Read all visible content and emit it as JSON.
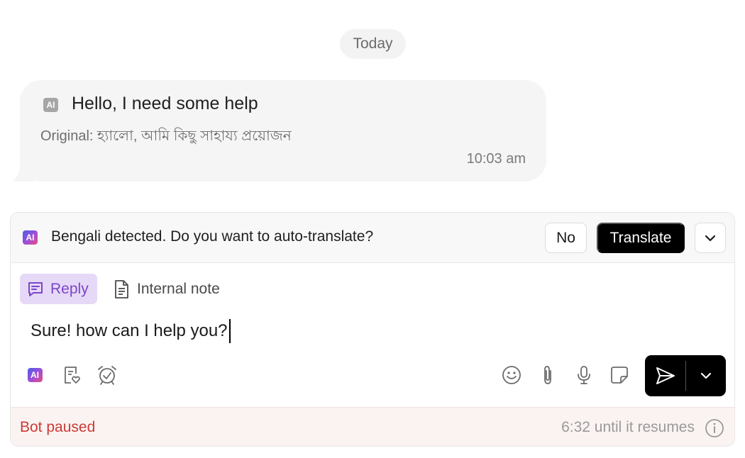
{
  "chat": {
    "date_divider": "Today",
    "message": {
      "ai_badge": "AI",
      "text": "Hello, I need some help",
      "original": "Original: হ্যালো, আমি কিছু সাহায্য প্রয়োজন",
      "time": "10:03 am"
    }
  },
  "translate_bar": {
    "ai_badge": "AI",
    "prompt": "Bengali detected. Do you want to auto-translate?",
    "no_label": "No",
    "translate_label": "Translate"
  },
  "composer": {
    "tabs": [
      {
        "label": "Reply",
        "active": true
      },
      {
        "label": "Internal note",
        "active": false
      }
    ],
    "input_value": "Sure! how can I help you?",
    "ai_badge": "AI",
    "left_tools": [
      "ai-assist-icon",
      "knowledge-doc-icon",
      "snooze-alarm-icon"
    ],
    "right_tools": [
      "emoji-icon",
      "attachment-icon",
      "microphone-icon",
      "sticker-icon"
    ],
    "send_icon": "send-icon"
  },
  "status": {
    "bot_state": "Bot paused",
    "resume_text": "6:32 until it resumes"
  },
  "colors": {
    "accent_purple": "#7c45c9",
    "reply_tab_bg": "#e6d9f7",
    "paused_red": "#cc3b35",
    "send_button": "#000000"
  }
}
